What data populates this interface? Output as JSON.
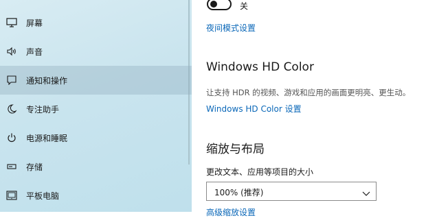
{
  "sidebar": {
    "items": [
      {
        "label": "屏幕",
        "icon": "monitor-icon"
      },
      {
        "label": "声音",
        "icon": "speaker-icon"
      },
      {
        "label": "通知和操作",
        "icon": "notification-icon"
      },
      {
        "label": "专注助手",
        "icon": "moon-icon"
      },
      {
        "label": "电源和睡眠",
        "icon": "power-icon"
      },
      {
        "label": "存储",
        "icon": "storage-icon"
      },
      {
        "label": "平板电脑",
        "icon": "tablet-icon"
      }
    ],
    "active_index": 2
  },
  "main": {
    "toggle": {
      "state_label": "关",
      "on": false
    },
    "night_mode_link": "夜间模式设置",
    "hdr": {
      "title": "Windows HD Color",
      "description": "让支持 HDR 的视频、游戏和应用的画面更明亮、更生动。",
      "link": "Windows HD Color 设置"
    },
    "scale": {
      "title": "缩放与布局",
      "label": "更改文本、应用等项目的大小",
      "selected": "100% (推荐)",
      "advanced_link": "高级缩放设置"
    }
  },
  "colors": {
    "accent_link": "#0a67b8",
    "sidebar_bg": "#c9e4ee"
  }
}
